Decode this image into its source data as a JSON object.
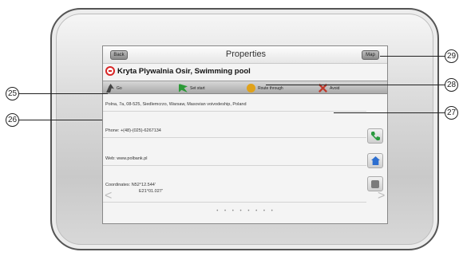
{
  "screen": {
    "title": "Properties",
    "back_label": "Back",
    "map_label": "Map",
    "poi_name": "Kryta Plywalnia Osir, Swimming pool"
  },
  "actions": [
    {
      "label": "Go",
      "icon": "go-icon"
    },
    {
      "label": "Set start",
      "icon": "set-start-flag-icon"
    },
    {
      "label": "Route through",
      "icon": "route-through-icon"
    },
    {
      "label": "Avoid",
      "icon": "avoid-icon"
    }
  ],
  "details": {
    "address": "Polna, 7a, 08-525, Siedlemcrzo, Warsaw, Masovian voivodeship, Poland",
    "phone": "Phone: +(48)-(025)-6267134",
    "web": "Web: www.polbank.pl",
    "coordinates_label": "Coordinates:",
    "coordinates_lat": "N52°12.544'",
    "coordinates_lon": "E21°01.027'"
  },
  "page_indicator": "• • • • • • • •",
  "nav": {
    "prev": "<",
    "next": ">"
  },
  "callouts": [
    "25",
    "26",
    "27",
    "28",
    "29"
  ],
  "colors": {
    "poi_icon": "#d82626",
    "call": "#2a9a3e",
    "home": "#2e6fd0"
  }
}
